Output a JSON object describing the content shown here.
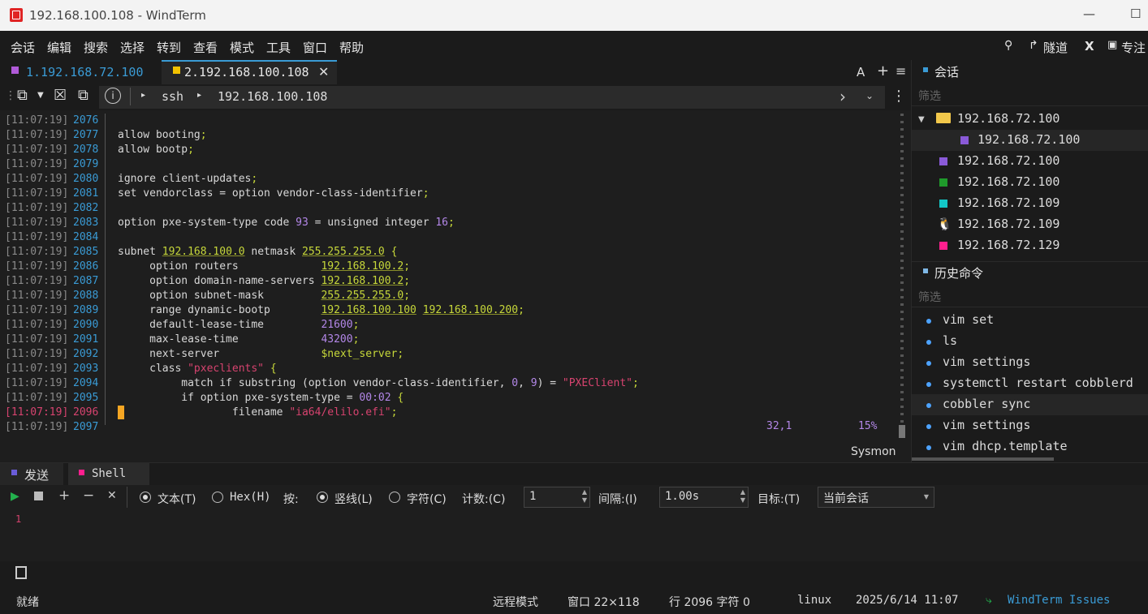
{
  "window": {
    "title": "192.168.100.108 - WindTerm"
  },
  "menu": [
    "会话",
    "编辑",
    "搜索",
    "选择",
    "转到",
    "查看",
    "模式",
    "工具",
    "窗口",
    "帮助"
  ],
  "menu_right": {
    "tunnel": "隧道",
    "x_label": "X",
    "focus": "专注"
  },
  "tabs": [
    {
      "label": "1.192.168.72.100",
      "color": "#b05ad8",
      "active": false
    },
    {
      "label": "2.192.168.100.108",
      "color": "#f2c200",
      "active": true
    }
  ],
  "tab_right": {
    "font_label": "A",
    "add": "+",
    "menu": "≡"
  },
  "address": {
    "protocol": "ssh",
    "host": "192.168.100.108"
  },
  "terminal": {
    "lines": [
      {
        "ts": "[11:07:19]",
        "ln": "2076",
        "code": ""
      },
      {
        "ts": "[11:07:19]",
        "ln": "2077",
        "code": "allow booting;"
      },
      {
        "ts": "[11:07:19]",
        "ln": "2078",
        "code": "allow bootp;"
      },
      {
        "ts": "[11:07:19]",
        "ln": "2079",
        "code": ""
      },
      {
        "ts": "[11:07:19]",
        "ln": "2080",
        "code": "ignore client-updates;"
      },
      {
        "ts": "[11:07:19]",
        "ln": "2081",
        "code": "set vendorclass = option vendor-class-identifier;"
      },
      {
        "ts": "[11:07:19]",
        "ln": "2082",
        "code": ""
      },
      {
        "ts": "[11:07:19]",
        "ln": "2083",
        "code": "option pxe-system-type code 93 = unsigned integer 16;"
      },
      {
        "ts": "[11:07:19]",
        "ln": "2084",
        "code": ""
      },
      {
        "ts": "[11:07:19]",
        "ln": "2085",
        "code": "subnet 192.168.100.0 netmask 255.255.255.0 {"
      },
      {
        "ts": "[11:07:19]",
        "ln": "2086",
        "code": "     option routers             192.168.100.2;"
      },
      {
        "ts": "[11:07:19]",
        "ln": "2087",
        "code": "     option domain-name-servers 192.168.100.2;"
      },
      {
        "ts": "[11:07:19]",
        "ln": "2088",
        "code": "     option subnet-mask         255.255.255.0;"
      },
      {
        "ts": "[11:07:19]",
        "ln": "2089",
        "code": "     range dynamic-bootp        192.168.100.100 192.168.100.200;"
      },
      {
        "ts": "[11:07:19]",
        "ln": "2090",
        "code": "     default-lease-time         21600;"
      },
      {
        "ts": "[11:07:19]",
        "ln": "2091",
        "code": "     max-lease-time             43200;"
      },
      {
        "ts": "[11:07:19]",
        "ln": "2092",
        "code": "     next-server                $next_server;"
      },
      {
        "ts": "[11:07:19]",
        "ln": "2093",
        "code": "     class \"pxeclients\" {"
      },
      {
        "ts": "[11:07:19]",
        "ln": "2094",
        "code": "          match if substring (option vendor-class-identifier, 0, 9) = \"PXEClient\";"
      },
      {
        "ts": "[11:07:19]",
        "ln": "2095",
        "code": "          if option pxe-system-type = 00:02 {"
      },
      {
        "ts": "[11:07:19]",
        "ln": "2096",
        "code": "                  filename \"ia64/elilo.efi\";"
      },
      {
        "ts": "[11:07:19]",
        "ln": "2097",
        "code": ""
      }
    ],
    "cursor_pos": "32,1",
    "percent": "15%",
    "sysmon": "Sysmon"
  },
  "sidebar": {
    "sessions_title": "会话",
    "sessions_filter": "筛选",
    "sessions": [
      {
        "label": "192.168.72.100",
        "kind": "folder"
      },
      {
        "label": "192.168.72.100",
        "kind": "child",
        "color": "#8a5ad8"
      },
      {
        "label": "192.168.72.100",
        "kind": "item",
        "color": "#8a5ad8"
      },
      {
        "label": "192.168.72.100",
        "kind": "item",
        "color": "#1f9a2b"
      },
      {
        "label": "192.168.72.109",
        "kind": "item",
        "color": "#13c6c6"
      },
      {
        "label": "192.168.72.109",
        "kind": "linux"
      },
      {
        "label": "192.168.72.129",
        "kind": "item",
        "color": "#ff1f8e"
      }
    ],
    "history_title": "历史命令",
    "history_filter": "筛选",
    "history": [
      "vim set",
      "ls",
      "vim settings",
      "systemctl restart cobblerd",
      "cobbler sync",
      "vim settings",
      "vim dhcp.template"
    ]
  },
  "send_panel": {
    "tabs": [
      {
        "label": "发送",
        "color": "#6a5cd8"
      },
      {
        "label": "Shell",
        "color": "#ff1f8e"
      }
    ],
    "text_mode": "文本(T)",
    "hex_mode": "Hex(H)",
    "by_label": "按:",
    "vertical": "竖线(L)",
    "char": "字符(C)",
    "count_label": "计数:(C)",
    "count_value": "1",
    "interval_label": "间隔:(I)",
    "interval_value": "1.00s",
    "target_label": "目标:(T)",
    "target_value": "当前会话",
    "line_no": "1"
  },
  "status": {
    "ready": "就绪",
    "mode": "远程模式",
    "window_size": "窗口 22×118",
    "line_char": "行 2096 字符 0",
    "os": "linux",
    "datetime": "2025/6/14 11:07",
    "issues": "WindTerm Issues"
  }
}
